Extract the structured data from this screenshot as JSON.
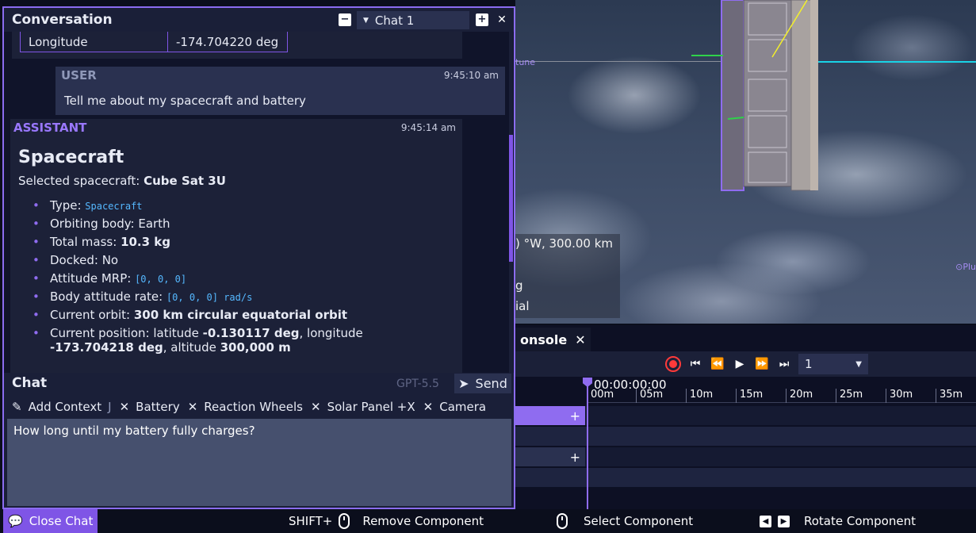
{
  "viewport": {
    "label_neptune": "tune",
    "label_pluto": "⊙Plu",
    "info_lines": [
      ") °W, 300.00 km",
      "g",
      "ial"
    ]
  },
  "timeline": {
    "tab_label": "onsole",
    "speed_value": "1",
    "current_time": "00:00:00:00",
    "ticks": [
      "00m",
      "05m",
      "10m",
      "15m",
      "20m",
      "25m",
      "30m",
      "35m"
    ]
  },
  "conversation": {
    "title": "Conversation",
    "selected_chat": "Chat 1",
    "previous_row": {
      "key": "Longitude",
      "value": "-174.704220 deg"
    },
    "user_message": {
      "role": "USER",
      "time": "9:45:10 am",
      "text": "Tell me about my spacecraft and battery"
    },
    "assistant_message": {
      "role": "ASSISTANT",
      "time": "9:45:14 am",
      "heading": "Spacecraft",
      "selected_prefix": "Selected spacecraft: ",
      "selected_name": "Cube Sat 3U",
      "facts": {
        "type_label": "Type: ",
        "type_value": "Spacecraft",
        "orbiting": "Orbiting body: Earth",
        "mass_label": "Total mass: ",
        "mass_value": "10.3 kg",
        "docked": "Docked: No",
        "mrp_label": "Attitude MRP: ",
        "mrp_value": "[0, 0, 0]",
        "rate_label": "Body attitude rate: ",
        "rate_value": "[0, 0, 0] rad/s",
        "orbit_label": "Current orbit: ",
        "orbit_value": "300 km circular equatorial orbit",
        "pos_label": "Current position: latitude ",
        "pos_lat": "-0.130117 deg",
        "pos_mid": ", longitude",
        "pos_lon": "-173.704218 deg",
        "pos_alt_label": ", altitude ",
        "pos_alt": "300,000 m"
      }
    }
  },
  "chat": {
    "label": "Chat",
    "model": "GPT-5.5",
    "send_label": "Send",
    "add_context_label": "Add Context",
    "context_cut": "J",
    "context_chips": [
      "Battery",
      "Reaction Wheels",
      "Solar Panel +X",
      "Camera"
    ],
    "input_value": "How long until my battery fully charges?"
  },
  "statusbar": {
    "close_chat": "Close Chat",
    "shift_label": "SHIFT+",
    "remove_component": "Remove Component",
    "select_component": "Select Component",
    "rotate_component": "Rotate Component"
  },
  "colors": {
    "accent": "#8b6cf0",
    "record": "#ff3a3a",
    "code": "#55b8ff"
  }
}
